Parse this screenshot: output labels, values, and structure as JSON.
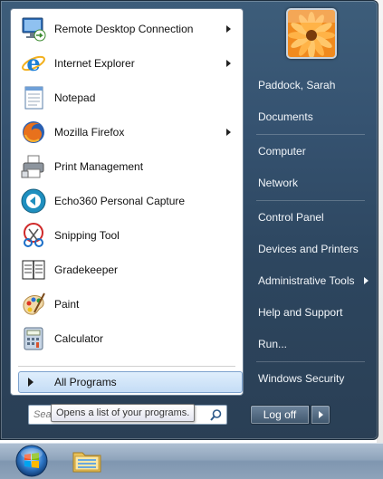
{
  "programs": [
    {
      "label": "Remote Desktop Connection",
      "icon": "remote-desktop-icon",
      "has_submenu": true
    },
    {
      "label": "Internet Explorer",
      "icon": "internet-explorer-icon",
      "has_submenu": true
    },
    {
      "label": "Notepad",
      "icon": "notepad-icon",
      "has_submenu": false
    },
    {
      "label": "Mozilla Firefox",
      "icon": "firefox-icon",
      "has_submenu": true
    },
    {
      "label": "Print Management",
      "icon": "printer-icon",
      "has_submenu": false
    },
    {
      "label": "Echo360 Personal Capture",
      "icon": "echo360-icon",
      "has_submenu": false
    },
    {
      "label": "Snipping Tool",
      "icon": "scissors-icon",
      "has_submenu": false
    },
    {
      "label": "Gradekeeper",
      "icon": "gradebook-icon",
      "has_submenu": false
    },
    {
      "label": "Paint",
      "icon": "paint-palette-icon",
      "has_submenu": false
    },
    {
      "label": "Calculator",
      "icon": "calculator-icon",
      "has_submenu": false
    }
  ],
  "all_programs": {
    "label": "All Programs"
  },
  "search": {
    "placeholder": "Search programs and files",
    "visible_text": "Sea"
  },
  "tooltip": {
    "text": "Opens a list of your programs."
  },
  "right_pane": {
    "user_name": "Paddock, Sarah",
    "items": [
      {
        "label": "Paddock, Sarah"
      },
      {
        "label": "Documents"
      },
      {
        "label": "Computer"
      },
      {
        "label": "Network"
      },
      {
        "label": "Control Panel"
      },
      {
        "label": "Devices and Printers"
      },
      {
        "label": "Administrative Tools",
        "has_submenu": true
      },
      {
        "label": "Help and Support"
      },
      {
        "label": "Run..."
      },
      {
        "label": "Windows Security"
      }
    ]
  },
  "logoff": {
    "label": "Log off"
  },
  "taskbar": {
    "items": [
      "start-orb-icon",
      "windows-explorer-icon"
    ]
  },
  "colors": {
    "menu_frame": "#355270",
    "highlight": "#c5ddf6",
    "text_light": "#f2f6fa"
  }
}
